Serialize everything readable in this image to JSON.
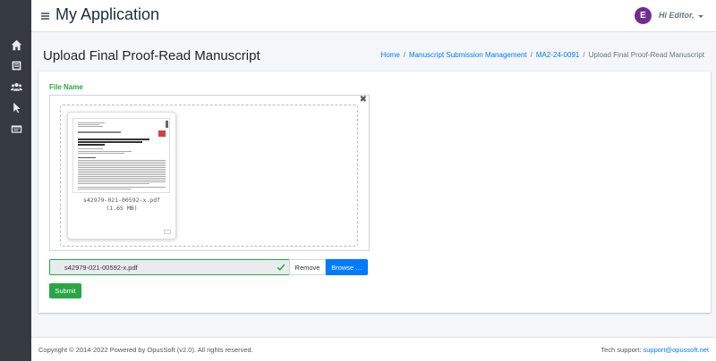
{
  "sidebar": {
    "icons": [
      "home-icon",
      "book-icon",
      "users-icon",
      "pointer-icon",
      "id-card-icon"
    ]
  },
  "header": {
    "app_title": "My Application",
    "avatar_letter": "E",
    "greeting": "Hi Editor,",
    "avatar_color": "#6f2c91"
  },
  "page": {
    "title": "Upload Final Proof-Read Manuscript",
    "breadcrumb": {
      "home": "Home",
      "section": "Manuscript Submission Management",
      "record": "MA2-24-0091",
      "current": "Upload Final Proof-Read Manuscript"
    }
  },
  "form": {
    "file_label": "File Name",
    "close_symbol": "✖",
    "preview": {
      "file_name": "s42979-021-00592-x.pdf",
      "file_size": "(1.65 MB)"
    },
    "caption_value": "s42979-021-00592-x.pdf",
    "remove_label": "Remove",
    "browse_label": "Browse …",
    "submit_label": "Submit"
  },
  "footer": {
    "copyright": "Copyright © 2014-2022 Powered by OpusSoft (v2.0). All rights reserved.",
    "support_label": "Tech support:",
    "support_email": "support@opussoft.net"
  },
  "colors": {
    "sidebar_bg": "#343a40",
    "primary": "#007bff",
    "success": "#28a745"
  }
}
